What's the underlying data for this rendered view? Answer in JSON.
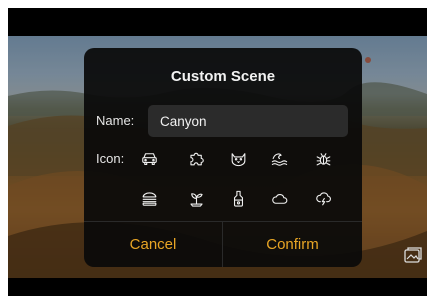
{
  "dialog": {
    "title": "Custom Scene",
    "name_label": "Name:",
    "name_value": "Canyon",
    "icon_label": "Icon:",
    "icons": [
      "car-icon",
      "puzzle-icon",
      "cat-icon",
      "waves-icon",
      "bug-icon",
      "burger-icon",
      "plant-icon",
      "bottle-icon",
      "cloud-icon",
      "cloud-lightning-icon"
    ],
    "cancel_label": "Cancel",
    "confirm_label": "Confirm"
  },
  "colors": {
    "accent": "#e8a525",
    "dialog_bg": "#0a0a0a",
    "input_bg": "#2b2b2b"
  }
}
